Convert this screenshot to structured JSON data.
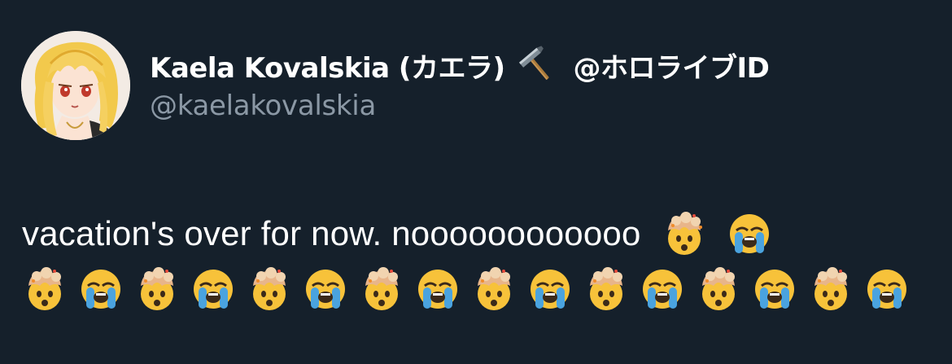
{
  "tweet": {
    "author": {
      "display_name": "Kaela Kovalskia (カエラ)",
      "badge_icon": "hammer-icon",
      "affiliation": "@ホロライブID",
      "handle": "@kaelakovalskia",
      "avatar_icon": "profile-avatar"
    },
    "text": "vacation's over for now. noooooooooooo",
    "emoji_sequence": [
      "exploding-head-icon",
      "loudly-crying-face-icon",
      "exploding-head-icon",
      "loudly-crying-face-icon",
      "exploding-head-icon",
      "loudly-crying-face-icon",
      "exploding-head-icon",
      "loudly-crying-face-icon",
      "exploding-head-icon",
      "loudly-crying-face-icon",
      "exploding-head-icon",
      "loudly-crying-face-icon",
      "exploding-head-icon",
      "loudly-crying-face-icon",
      "exploding-head-icon",
      "loudly-crying-face-icon"
    ]
  },
  "colors": {
    "background": "#15202b",
    "primary_text": "#ffffff",
    "secondary_text": "#8b98a5"
  }
}
